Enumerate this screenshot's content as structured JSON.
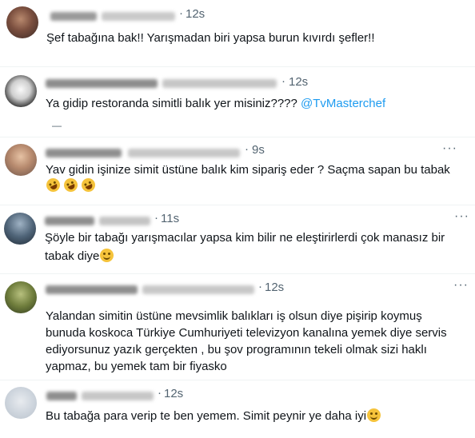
{
  "tweets": [
    {
      "time": "12s",
      "text": "Şef tabağına bak!! Yarışmadan biri yapsa burun kıvırdı şefler!!"
    },
    {
      "time": "12s",
      "text": "Ya gidip restoranda simitli balık yer misiniz????",
      "mention": "@TvMasterchef"
    },
    {
      "time": "9s",
      "text": "Yav gidin işinize simit üstüne balık kim sipariş eder ? Saçma sapan bu tabak",
      "more": "···"
    },
    {
      "time": "11s",
      "line1": "Şöyle bir tabağı yarışmacılar yapsa kim bilir ne eleştirirlerdi çok manasız bir",
      "line2": "tabak diye",
      "more": "···"
    },
    {
      "time": "12s",
      "line1": "Yalandan simitin üstüne mevsimlik balıkları iş olsun diye pişirip koymuş",
      "line2": "bunuda koskoca Türkiye Cumhuriyeti televizyon kanalına yemek diye servis",
      "line3": "ediyorsunuz yazık gerçekten , bu şov programının tekeli olmak sizi haklı",
      "line4": "yapmaz, bu yemek tam bir fiyasko",
      "more": "···"
    },
    {
      "time": "12s",
      "text": "Bu tabağa para verip te ben yemem. Simit peynir ye daha iyi"
    }
  ],
  "icons": {
    "emoji": "smiling-face-emoji",
    "rofl": "rolling-on-floor-laughing-emoji"
  },
  "colors": {
    "text": "#0f1419",
    "secondary": "#536471",
    "link": "#1d9bf0",
    "divider": "#eff3f4"
  }
}
